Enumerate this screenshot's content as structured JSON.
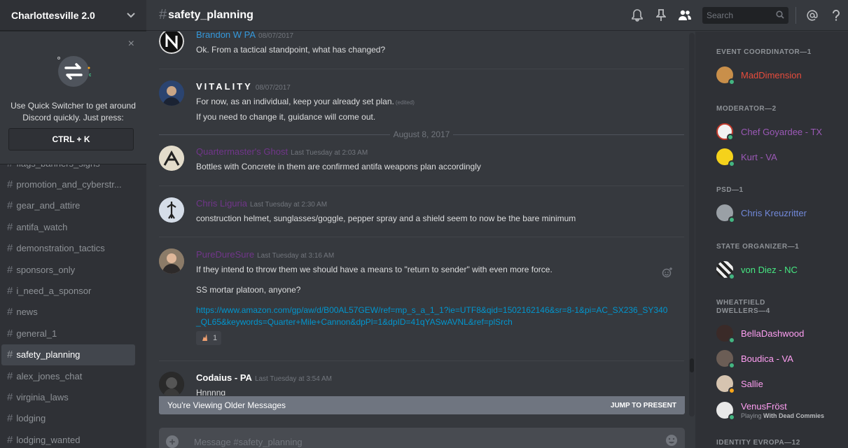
{
  "server": {
    "name": "Charlottesville 2.0"
  },
  "quick_switcher": {
    "text": "Use Quick Switcher to get around Discord quickly. Just press:",
    "shortcut": "CTRL + K",
    "close": "×"
  },
  "channels": [
    "flags_banners_signs",
    "promotion_and_cyberstr...",
    "gear_and_attire",
    "antifa_watch",
    "demonstration_tactics",
    "sponsors_only",
    "i_need_a_sponsor",
    "news",
    "general_1",
    "safety_planning",
    "alex_jones_chat",
    "virginia_laws",
    "lodging",
    "lodging_wanted"
  ],
  "active_channel": "safety_planning",
  "header": {
    "hash": "#",
    "channel": "safety_planning",
    "search_placeholder": "Search"
  },
  "messages": [
    {
      "author": "Brandon W PA",
      "author_color": "#3498db",
      "timestamp": "08/07/2017",
      "lines": [
        "Ok. From a tactical standpoint, what has changed?"
      ]
    },
    {
      "author": "VITALITY",
      "author_color": "#ffffff",
      "timestamp": "08/07/2017",
      "lines": [
        "For now, as an individual, keep your already set plan.",
        "If you need to change it, guidance will come out."
      ],
      "edited": "(edited)"
    },
    {
      "author": "Quartermaster's Ghost",
      "author_color": "#71368a",
      "timestamp": "Last Tuesday at 2:03 AM",
      "lines": [
        "Bottles with Concrete in them are confirmed antifa weapons plan accordingly"
      ]
    },
    {
      "author": "Chris Liguria",
      "author_color": "#71368a",
      "timestamp": "Last Tuesday at 2:30 AM",
      "lines": [
        "construction helmet, sunglasses/goggle, pepper spray and a shield seem to now be the bare minimum"
      ]
    },
    {
      "author": "PureDureSure",
      "author_color": "#71368a",
      "timestamp": "Last Tuesday at 3:16 AM",
      "lines": [
        "If they intend to throw them we should have a means to \"return to sender\" with even more force.",
        "SS mortar platoon, anyone?"
      ],
      "link": "https://www.amazon.com/gp/aw/d/B00AL57GEW/ref=mp_s_a_1_1?ie=UTF8&qid=1502162146&sr=8-1&pi=AC_SX236_SY340_QL65&keywords=Quarter+Mile+Cannon&dpPl=1&dpID=41qYASwAVNL&ref=plSrch",
      "reaction_count": "1"
    },
    {
      "author": "Codaius - PA",
      "author_color": "#ffffff",
      "timestamp": "Last Tuesday at 3:54 AM",
      "lines": [
        "Hnnnng"
      ]
    }
  ],
  "date_divider": "August 8, 2017",
  "older_bar": {
    "text": "You're Viewing Older Messages",
    "jump": "JUMP TO PRESENT"
  },
  "composer": {
    "placeholder": "Message #safety_planning"
  },
  "member_list": {
    "roles": [
      {
        "title": "EVENT COORDINATOR—1",
        "members": [
          {
            "name": "MadDimension",
            "color": "#e74c3c",
            "status": "#43b581"
          }
        ]
      },
      {
        "title": "MODERATOR—2",
        "members": [
          {
            "name": "Chef Goyardee - TX",
            "color": "#9b59b6",
            "status": "#43b581"
          },
          {
            "name": "Kurt - VA",
            "color": "#9b59b6",
            "status": "#43b581"
          }
        ]
      },
      {
        "title": "PSD—1",
        "members": [
          {
            "name": "Chris Kreuzritter",
            "color": "#7289da",
            "status": "#43b581"
          }
        ]
      },
      {
        "title": "STATE ORGANIZER—1",
        "members": [
          {
            "name": "von Diez - NC",
            "color": "#46e882",
            "status": "#43b581"
          }
        ]
      },
      {
        "title": "WHEATFIELD DWELLERS—4",
        "members": [
          {
            "name": "BellaDashwood",
            "color": "#ff9ff3",
            "status": "#43b581"
          },
          {
            "name": "Boudica - VA",
            "color": "#ff9ff3",
            "status": "#43b581"
          },
          {
            "name": "Sallie",
            "color": "#ff9ff3",
            "status": "#faa61a"
          },
          {
            "name": "VenusFröst",
            "color": "#ff9ff3",
            "status": "#43b581",
            "game_prefix": "Playing",
            "game": "With Dead Commies"
          }
        ]
      },
      {
        "title": "IDENTITY EVROPA—12",
        "members": []
      }
    ]
  },
  "colors": {
    "background": "#36393e",
    "sidebar": "#2f3136",
    "link": "#0096cf"
  }
}
